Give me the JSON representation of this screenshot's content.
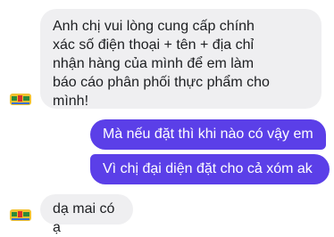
{
  "conversation": {
    "messages": [
      {
        "direction": "incoming",
        "text": "Anh chị vui lòng cung cấp chính\nxác số điện thoại + tên + địa chỉ\nnhận hàng của mình để em làm\nbáo cáo phân phối thực phẩm cho\nmình!"
      },
      {
        "direction": "outgoing",
        "text": "Mà nếu đặt thì khi nào có vậy em"
      },
      {
        "direction": "outgoing",
        "text": "Vì chị đại diện đặt cho cả xóm ak"
      },
      {
        "direction": "incoming",
        "text": "dạ mai có ạ"
      }
    ]
  },
  "colors": {
    "incoming_bubble": "#efeff1",
    "outgoing_bubble": "#5b3fe8",
    "incoming_text": "#1c1e21",
    "outgoing_text": "#ffffff"
  },
  "icons": {
    "sender_avatar": "shop-logo-avatar"
  }
}
